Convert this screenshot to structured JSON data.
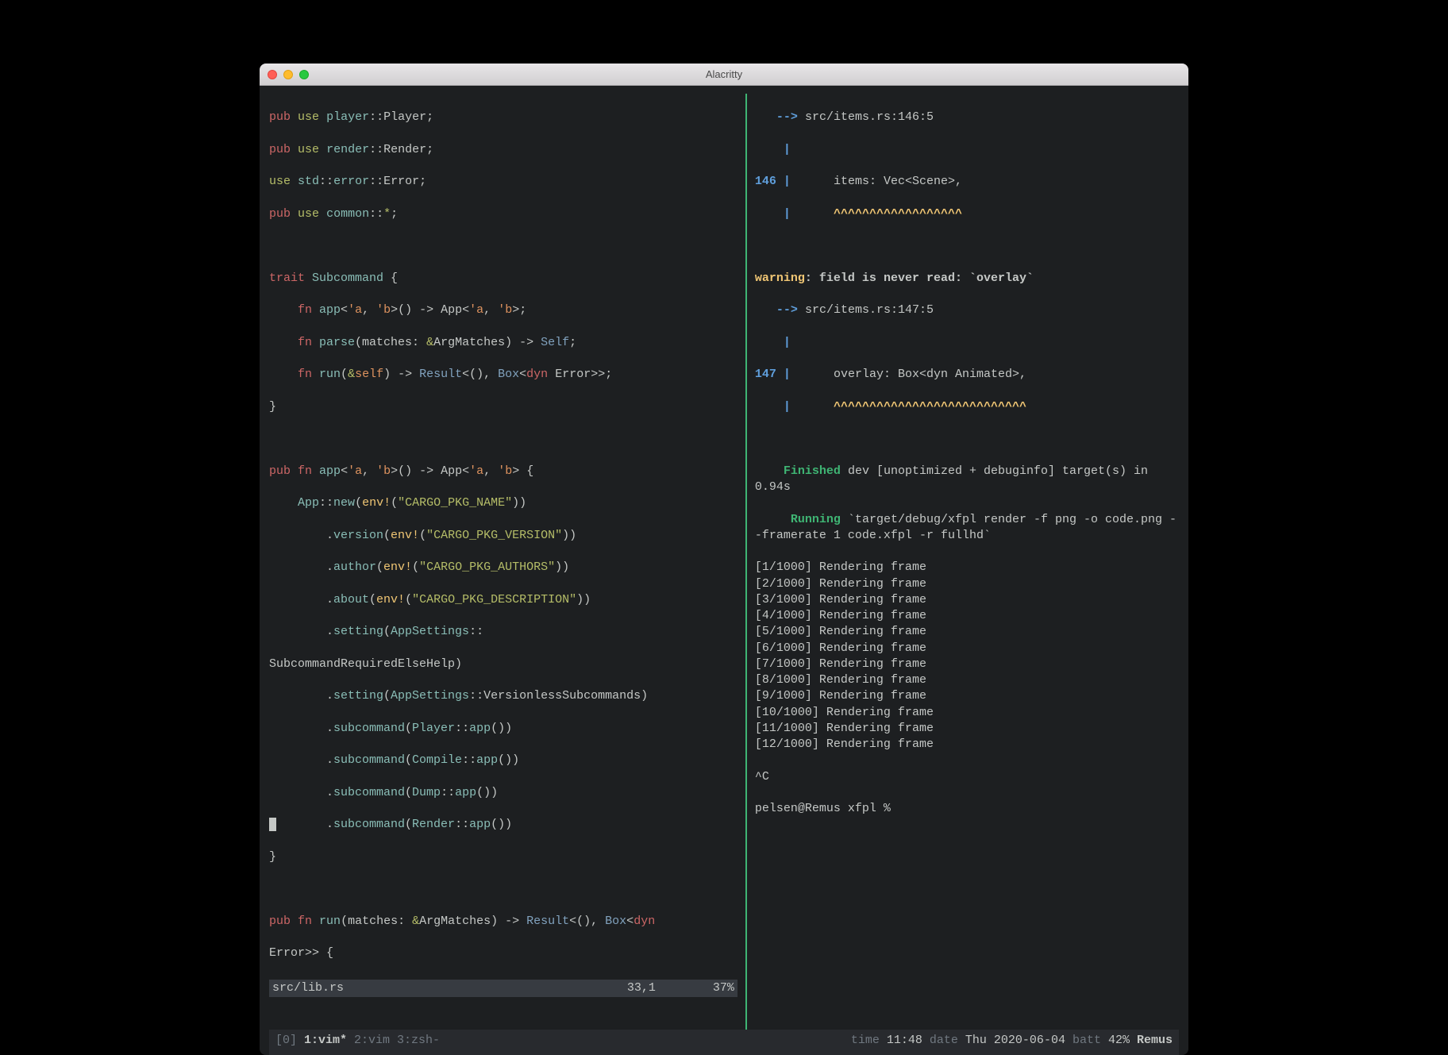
{
  "window": {
    "title": "Alacritty"
  },
  "left": {
    "l1": {
      "pub": "pub",
      "use": "use",
      "ns": "player",
      "sep": "::",
      "ty": "Player",
      "end": ";"
    },
    "l2": {
      "pub": "pub",
      "use": "use",
      "ns": "render",
      "sep": "::",
      "ty": "Render",
      "end": ";"
    },
    "l3": {
      "use": "use",
      "ns": "std",
      "sep": "::",
      "ns2": "error",
      "sep2": "::",
      "ty": "Error",
      "end": ";"
    },
    "l4": {
      "pub": "pub",
      "use": "use",
      "ns": "common",
      "sep": "::",
      "star": "*",
      "end": ";"
    },
    "l5": {
      "kw": "trait",
      "ty": "Subcommand",
      "brace": " {"
    },
    "l6": {
      "ind": "    ",
      "kw": "fn",
      "name": " app",
      "g1": "<",
      "lt1": "'a",
      "c1": ", ",
      "lt2": "'b",
      "g2": ">() -> ",
      "ty": "App",
      "g3": "<",
      "lt3": "'a",
      "c2": ", ",
      "lt4": "'b",
      "g4": ">;"
    },
    "l7": {
      "ind": "    ",
      "kw": "fn",
      "name": " parse",
      "p1": "(matches: ",
      "amp": "&",
      "ty": "ArgMatches",
      "p2": ") -> ",
      "slf": "Self",
      "end": ";"
    },
    "l8": {
      "ind": "    ",
      "kw": "fn",
      "name": " run",
      "p1": "(",
      "amp": "&",
      "slf": "self",
      "p2": ") -> ",
      "ty": "Result",
      "g1": "<(), ",
      "box": "Box",
      "g2": "<",
      "dyn": "dyn ",
      "err": "Error",
      "g3": ">>;"
    },
    "l9": {
      "brace": "}"
    },
    "l10": {
      "pub": "pub",
      "kw": "fn",
      "name": " app",
      "g1": "<",
      "lt1": "'a",
      "c1": ", ",
      "lt2": "'b",
      "g2": ">() -> ",
      "ty": "App",
      "g3": "<",
      "lt3": "'a",
      "c2": ", ",
      "lt4": "'b",
      "g4": "> {"
    },
    "l11": {
      "ind": "    ",
      "ty": "App",
      "sep": "::",
      "m": "new",
      "p1": "(",
      "env": "env!",
      "p2": "(",
      "s": "\"CARGO_PKG_NAME\"",
      "p3": "))"
    },
    "l12": {
      "ind": "        .",
      "m": "version",
      "p1": "(",
      "env": "env!",
      "p2": "(",
      "s": "\"CARGO_PKG_VERSION\"",
      "p3": "))"
    },
    "l13": {
      "ind": "        .",
      "m": "author",
      "p1": "(",
      "env": "env!",
      "p2": "(",
      "s": "\"CARGO_PKG_AUTHORS\"",
      "p3": "))"
    },
    "l14": {
      "ind": "        .",
      "m": "about",
      "p1": "(",
      "env": "env!",
      "p2": "(",
      "s": "\"CARGO_PKG_DESCRIPTION\"",
      "p3": "))"
    },
    "l15": {
      "ind": "        .",
      "m": "setting",
      "p1": "(",
      "ty": "AppSettings",
      "sep": "::"
    },
    "l16": {
      "tail": "SubcommandRequiredElseHelp)"
    },
    "l17": {
      "ind": "        .",
      "m": "setting",
      "p1": "(",
      "ty": "AppSettings",
      "sep": "::",
      "variant": "VersionlessSubcommands",
      "p2": ")"
    },
    "l18": {
      "ind": "        .",
      "m": "subcommand",
      "p1": "(",
      "ty": "Player",
      "sep": "::",
      "call": "app",
      "p2": "())"
    },
    "l19": {
      "ind": "        .",
      "m": "subcommand",
      "p1": "(",
      "ty": "Compile",
      "sep": "::",
      "call": "app",
      "p2": "())"
    },
    "l20": {
      "ind": "        .",
      "m": "subcommand",
      "p1": "(",
      "ty": "Dump",
      "sep": "::",
      "call": "app",
      "p2": "())"
    },
    "l21": {
      "ind": "        .",
      "m": "subcommand",
      "p1": "(",
      "ty": "Render",
      "sep": "::",
      "call": "app",
      "p2": "())"
    },
    "l22": {
      "brace": "}"
    },
    "l23": {
      "pub": "pub",
      "kw": "fn",
      "name": " run",
      "p1": "(matches: ",
      "amp": "&",
      "ty": "ArgMatches",
      "p2": ") -> ",
      "ret": "Result",
      "g1": "<(), ",
      "box": "Box",
      "g2": "<",
      "dyn": "dyn"
    },
    "l24": {
      "cont": "Error",
      "g1": ">> {"
    },
    "status": {
      "file": "src/lib.rs",
      "pos": "33,1",
      "pct": "37%"
    }
  },
  "right": {
    "arrow1": "   --> ",
    "loc1": "src/items.rs:146:5",
    "pipe": "    |",
    "ln146": "146 ",
    "pipe2": "|",
    "field1": "      items: Vec<Scene>,",
    "caret1": "      ^^^^^^^^^^^^^^^^^^",
    "warn_lbl": "warning",
    "warn_txt": ": field is never read: `overlay`",
    "arrow2": "   --> ",
    "loc2": "src/items.rs:147:5",
    "ln147": "147 ",
    "field2": "      overlay: Box<dyn Animated>,",
    "caret2": "      ^^^^^^^^^^^^^^^^^^^^^^^^^^^",
    "fin_lbl": "    Finished",
    "fin_txt": " dev [unoptimized + debuginfo] target(s) in 0.94s",
    "run_lbl": "     Running",
    "run_txt": " `target/debug/xfpl render -f png -o code.png --framerate 1 code.xfpl -r fullhd`",
    "frames": [
      "[1/1000] Rendering frame",
      "[2/1000] Rendering frame",
      "[3/1000] Rendering frame",
      "[4/1000] Rendering frame",
      "[5/1000] Rendering frame",
      "[6/1000] Rendering frame",
      "[7/1000] Rendering frame",
      "[8/1000] Rendering frame",
      "[9/1000] Rendering frame",
      "[10/1000] Rendering frame",
      "[11/1000] Rendering frame",
      "[12/1000] Rendering frame"
    ],
    "ctrlc": "^C",
    "prompt": "pelsen@Remus xfpl % "
  },
  "tmux": {
    "left": {
      "idx": "[0] ",
      "w1": "1:vim*",
      "w2": " 2:vim ",
      "w3": " 3:zsh-"
    },
    "right": {
      "t_lbl": "time ",
      "t_val": "11:48",
      "d_lbl": " date ",
      "d_val": "Thu 2020-06-04",
      "b_lbl": " batt ",
      "b_val": "42%",
      "host": "  Remus"
    }
  }
}
